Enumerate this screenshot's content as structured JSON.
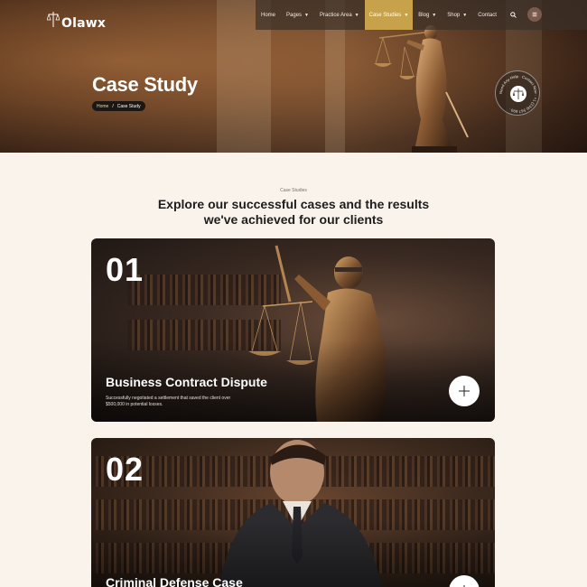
{
  "brand": {
    "name": "Olawx"
  },
  "nav": {
    "items": [
      {
        "label": "Home",
        "has_dropdown": false,
        "active": false
      },
      {
        "label": "Pages",
        "has_dropdown": true,
        "active": false
      },
      {
        "label": "Practice Area",
        "has_dropdown": true,
        "active": false
      },
      {
        "label": "Case Studies",
        "has_dropdown": true,
        "active": true
      },
      {
        "label": "Blog",
        "has_dropdown": true,
        "active": false
      },
      {
        "label": "Shop",
        "has_dropdown": true,
        "active": false
      },
      {
        "label": "Contact",
        "has_dropdown": false,
        "active": false
      }
    ],
    "icons": [
      "search-icon",
      "menu-icon"
    ]
  },
  "hero": {
    "title": "Case Study",
    "breadcrumb": {
      "home": "Home",
      "separator": "/",
      "current": "Case Study"
    },
    "badge_text": "Need Any Help · Contact Now · +1 (234) 567 890 ·"
  },
  "section": {
    "eyebrow": "Case Studies",
    "title_line1": "Explore our successful cases and the results",
    "title_line2": "we've achieved for our clients"
  },
  "cases": [
    {
      "number": "01",
      "title": "Business Contract Dispute",
      "desc_line1": "Successfully negotiated a settlement that saved the client over",
      "desc_line2": "$500,000 in potential losses."
    },
    {
      "number": "02",
      "title": "Criminal Defense Case",
      "desc_line1": "",
      "desc_line2": ""
    }
  ],
  "colors": {
    "accent": "#c8a24a",
    "page_bg": "#faf3ec",
    "nav_bg": "#3c3028",
    "text_dark": "#1d1d1d"
  }
}
